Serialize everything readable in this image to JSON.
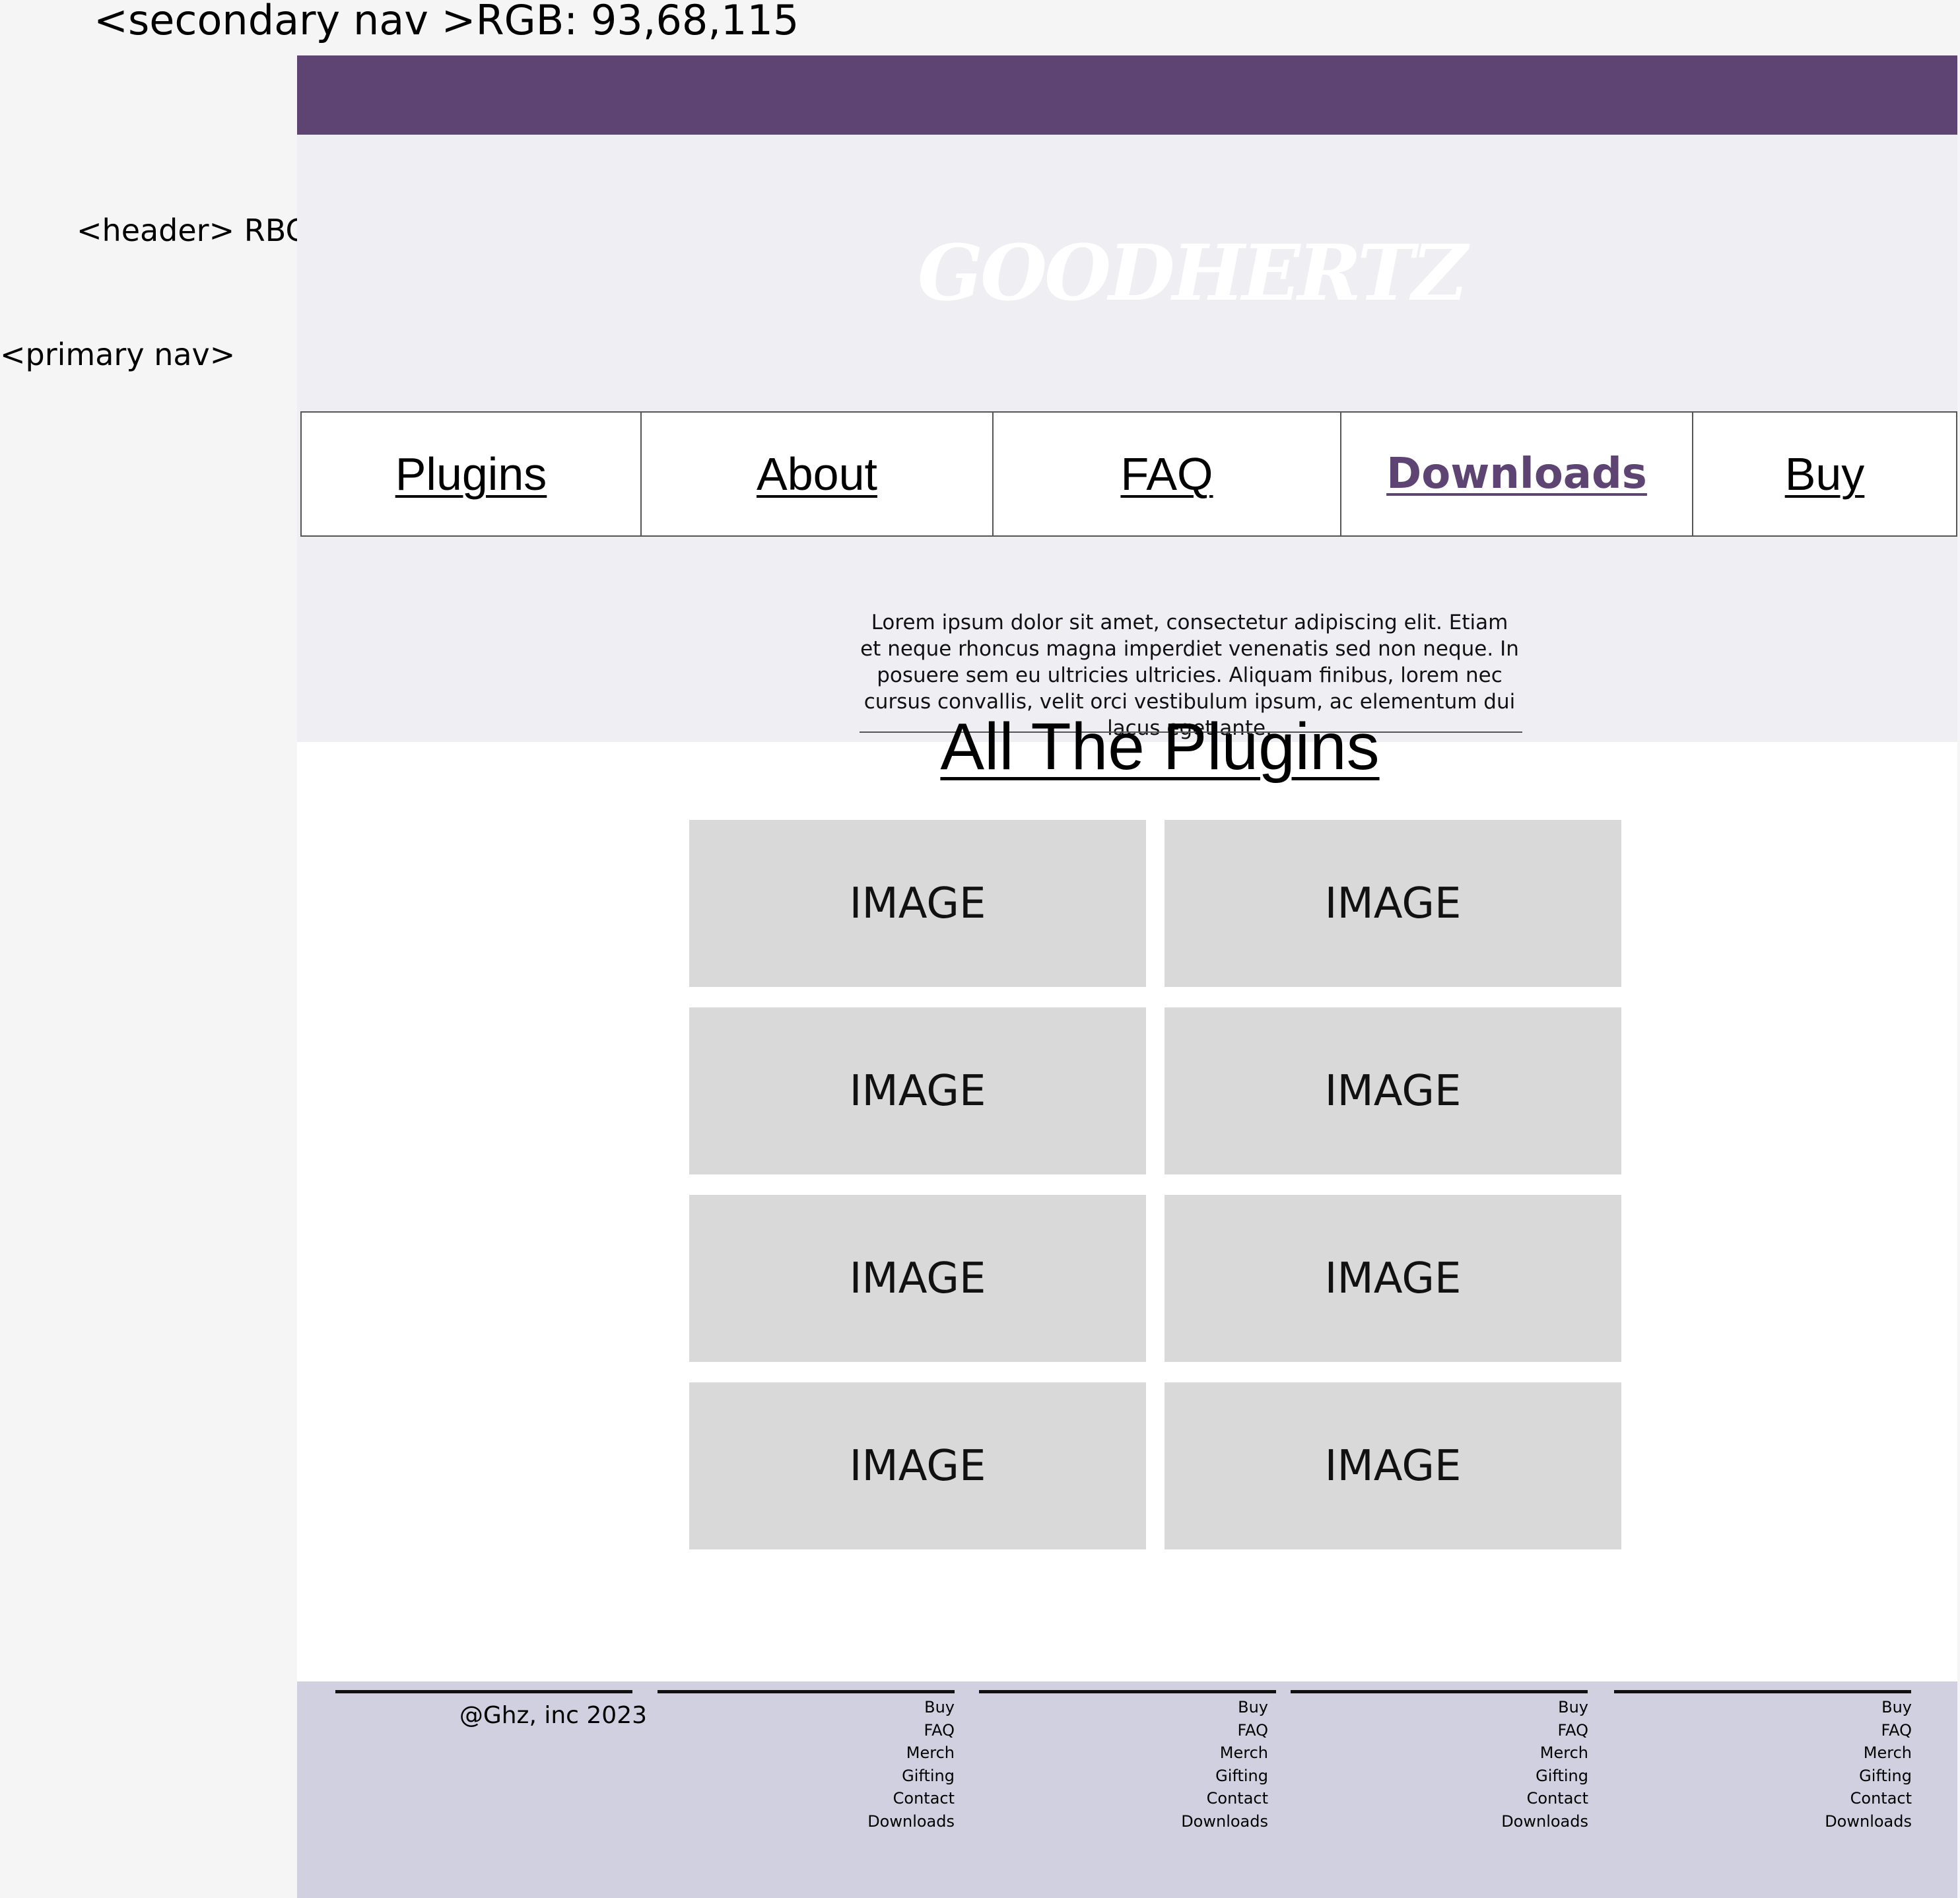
{
  "annotations": {
    "secondary_nav": "<secondary nav >RGB: 93,68,115",
    "header": "<header> RBG:",
    "primary_nav": "<primary nav>"
  },
  "colors": {
    "secondary_nav": "#5d4473",
    "header_bg": "#efeef2",
    "footer_bg": "#d1d0e0",
    "tile": "#d9d9d9"
  },
  "logo": {
    "text": "GOODHERTZ"
  },
  "primary_nav": {
    "items": [
      {
        "label": "Plugins",
        "active": false
      },
      {
        "label": "About",
        "active": false
      },
      {
        "label": "FAQ",
        "active": false
      },
      {
        "label": "Downloads",
        "active": true
      },
      {
        "label": "Buy",
        "active": false
      }
    ]
  },
  "intro": {
    "text": "Lorem ipsum dolor sit amet, consectetur adipiscing elit. Etiam et neque rhoncus magna imperdiet venenatis sed non neque. In posuere sem eu ultricies ultricies. Aliquam finibus, lorem nec cursus convallis, velit orci vestibulum ipsum, ac elementum dui lacus eget ante."
  },
  "plugins": {
    "title": "All The Plugins",
    "tiles": [
      "IMAGE",
      "IMAGE",
      "IMAGE",
      "IMAGE",
      "IMAGE",
      "IMAGE",
      "IMAGE",
      "IMAGE"
    ]
  },
  "footer": {
    "copyright": "@Ghz, inc 2023",
    "columns": [
      [
        "Buy",
        "FAQ",
        "Merch",
        "Gifting",
        "Contact",
        "Downloads"
      ],
      [
        "Buy",
        "FAQ",
        "Merch",
        "Gifting",
        "Contact",
        "Downloads"
      ],
      [
        "Buy",
        "FAQ",
        "Merch",
        "Gifting",
        "Contact",
        "Downloads"
      ],
      [
        "Buy",
        "FAQ",
        "Merch",
        "Gifting",
        "Contact",
        "Downloads"
      ]
    ]
  }
}
